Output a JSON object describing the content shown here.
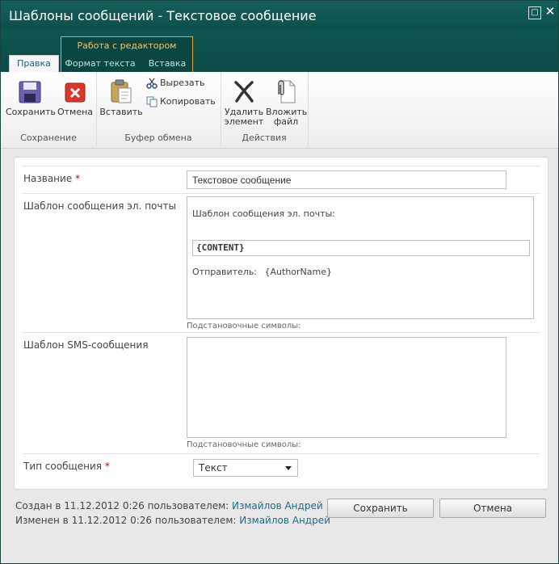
{
  "window": {
    "title": "Шаблоны сообщений - Текстовое сообщение",
    "maximize_icon": "maximize-icon",
    "close_icon": "close-icon"
  },
  "ribbon": {
    "context_group": "Работа с редактором",
    "tabs": [
      "Правка",
      "Формат текста",
      "Вставка"
    ],
    "active_tab": "Правка",
    "groups": {
      "save": {
        "label": "Сохранение",
        "save": "Сохранить",
        "cancel": "Отмена"
      },
      "clipboard": {
        "label": "Буфер обмена",
        "paste": "Вставить",
        "cut": "Вырезать",
        "copy": "Копировать"
      },
      "actions": {
        "label": "Действия",
        "delete_line1": "Удалить",
        "delete_line2": "элемент",
        "attach_line1": "Вложить",
        "attach_line2": "файл"
      }
    }
  },
  "form": {
    "name": {
      "label": "Название",
      "required": "*",
      "value": "Текстовое сообщение"
    },
    "email_template": {
      "label": "Шаблон сообщения эл. почты",
      "body_header": "Шаблон сообщения эл. почты:",
      "content_token": "{CONTENT}",
      "sender_label": "Отправитель:",
      "sender_token": "{AuthorName}",
      "hint": "Подстановочные символы:"
    },
    "sms_template": {
      "label": "Шаблон SMS-сообщения",
      "value": "",
      "hint": "Подстановочные символы:"
    },
    "message_type": {
      "label": "Тип сообщения",
      "required": "*",
      "selected": "Текст"
    }
  },
  "footer": {
    "created_prefix": "Создан в 11.12.2012 0:26 пользователем:",
    "created_user": "Измайлов Андрей",
    "modified_prefix": "Изменен в 11.12.2012 0:26 пользователем:",
    "modified_user": "Измайлов Андрей",
    "save_button": "Сохранить",
    "cancel_button": "Отмена"
  },
  "colors": {
    "titlebar": "#0d4f4b",
    "context_accent": "#e4a23a",
    "link": "#1c6b8a",
    "required": "#cc0000"
  }
}
